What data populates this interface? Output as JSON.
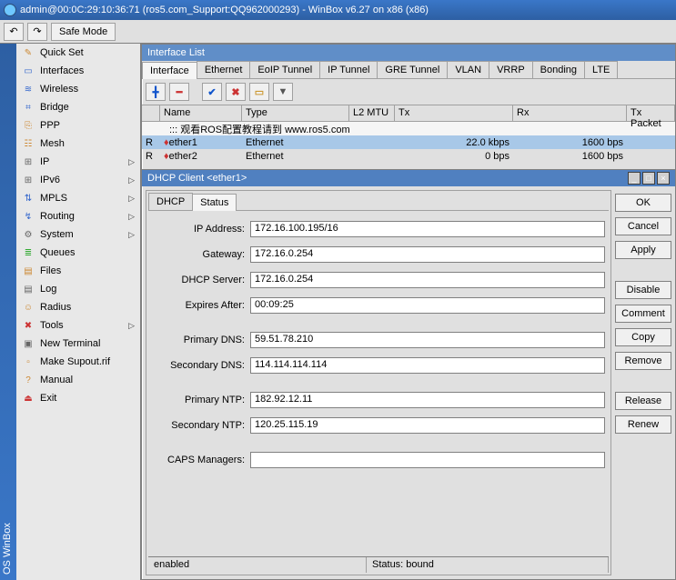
{
  "titlebar": "admin@00:0C:29:10:36:71 (ros5.com_Support:QQ962000293) - WinBox v6.27 on x86 (x86)",
  "toolbar": {
    "safe_mode": "Safe Mode"
  },
  "sidevert": "OS WinBox",
  "menu": [
    {
      "icon": "✎",
      "cls": "ico-orange",
      "label": "Quick Set",
      "arrow": false
    },
    {
      "icon": "▭",
      "cls": "ico-blue",
      "label": "Interfaces",
      "arrow": false
    },
    {
      "icon": "≋",
      "cls": "ico-blue",
      "label": "Wireless",
      "arrow": false
    },
    {
      "icon": "⌗",
      "cls": "ico-blue",
      "label": "Bridge",
      "arrow": false
    },
    {
      "icon": "⎘",
      "cls": "ico-orange",
      "label": "PPP",
      "arrow": false
    },
    {
      "icon": "☷",
      "cls": "ico-orange",
      "label": "Mesh",
      "arrow": false
    },
    {
      "icon": "⊞",
      "cls": "ico-grey",
      "label": "IP",
      "arrow": true
    },
    {
      "icon": "⊞",
      "cls": "ico-grey",
      "label": "IPv6",
      "arrow": true
    },
    {
      "icon": "⇅",
      "cls": "ico-blue",
      "label": "MPLS",
      "arrow": true
    },
    {
      "icon": "↯",
      "cls": "ico-blue",
      "label": "Routing",
      "arrow": true
    },
    {
      "icon": "⚙",
      "cls": "ico-grey",
      "label": "System",
      "arrow": true
    },
    {
      "icon": "≣",
      "cls": "ico-green",
      "label": "Queues",
      "arrow": false
    },
    {
      "icon": "▤",
      "cls": "ico-orange",
      "label": "Files",
      "arrow": false
    },
    {
      "icon": "▤",
      "cls": "ico-grey",
      "label": "Log",
      "arrow": false
    },
    {
      "icon": "☺",
      "cls": "ico-orange",
      "label": "Radius",
      "arrow": false
    },
    {
      "icon": "✖",
      "cls": "ico-red",
      "label": "Tools",
      "arrow": true
    },
    {
      "icon": "▣",
      "cls": "ico-grey",
      "label": "New Terminal",
      "arrow": false
    },
    {
      "icon": "▫",
      "cls": "ico-orange",
      "label": "Make Supout.rif",
      "arrow": false
    },
    {
      "icon": "?",
      "cls": "ico-orange",
      "label": "Manual",
      "arrow": false
    },
    {
      "icon": "⏏",
      "cls": "ico-red",
      "label": "Exit",
      "arrow": false
    }
  ],
  "iface_window": {
    "title": "Interface List",
    "tabs": [
      "Interface",
      "Ethernet",
      "EoIP Tunnel",
      "IP Tunnel",
      "GRE Tunnel",
      "VLAN",
      "VRRP",
      "Bonding",
      "LTE"
    ],
    "active_tab": 0,
    "columns": [
      "",
      "Name",
      "Type",
      "L2 MTU",
      "Tx",
      "Rx",
      "Tx Packet"
    ],
    "note_row": "::: 观看ROS配置教程请到 www.ros5.com",
    "rows": [
      {
        "flag": "R",
        "name": "ether1",
        "type": "Ethernet",
        "l2mtu": "",
        "tx": "22.0 kbps",
        "rx": "1600 bps",
        "sel": true
      },
      {
        "flag": "R",
        "name": "ether2",
        "type": "Ethernet",
        "l2mtu": "",
        "tx": "0 bps",
        "rx": "1600 bps",
        "sel": false
      }
    ]
  },
  "dhcp_window": {
    "title": "DHCP Client <ether1>",
    "tabs": [
      "DHCP",
      "Status"
    ],
    "active_tab": 1,
    "fields": {
      "ip_address": {
        "label": "IP Address:",
        "value": "172.16.100.195/16"
      },
      "gateway": {
        "label": "Gateway:",
        "value": "172.16.0.254"
      },
      "dhcp_server": {
        "label": "DHCP Server:",
        "value": "172.16.0.254"
      },
      "expires_after": {
        "label": "Expires After:",
        "value": "00:09:25"
      },
      "primary_dns": {
        "label": "Primary DNS:",
        "value": "59.51.78.210"
      },
      "secondary_dns": {
        "label": "Secondary DNS:",
        "value": "114.114.114.114"
      },
      "primary_ntp": {
        "label": "Primary NTP:",
        "value": "182.92.12.11"
      },
      "secondary_ntp": {
        "label": "Secondary NTP:",
        "value": "120.25.115.19"
      },
      "caps_managers": {
        "label": "CAPS Managers:",
        "value": ""
      }
    },
    "buttons": [
      "OK",
      "Cancel",
      "Apply",
      "Disable",
      "Comment",
      "Copy",
      "Remove",
      "Release",
      "Renew"
    ],
    "status_left": "enabled",
    "status_right": "Status: bound"
  }
}
